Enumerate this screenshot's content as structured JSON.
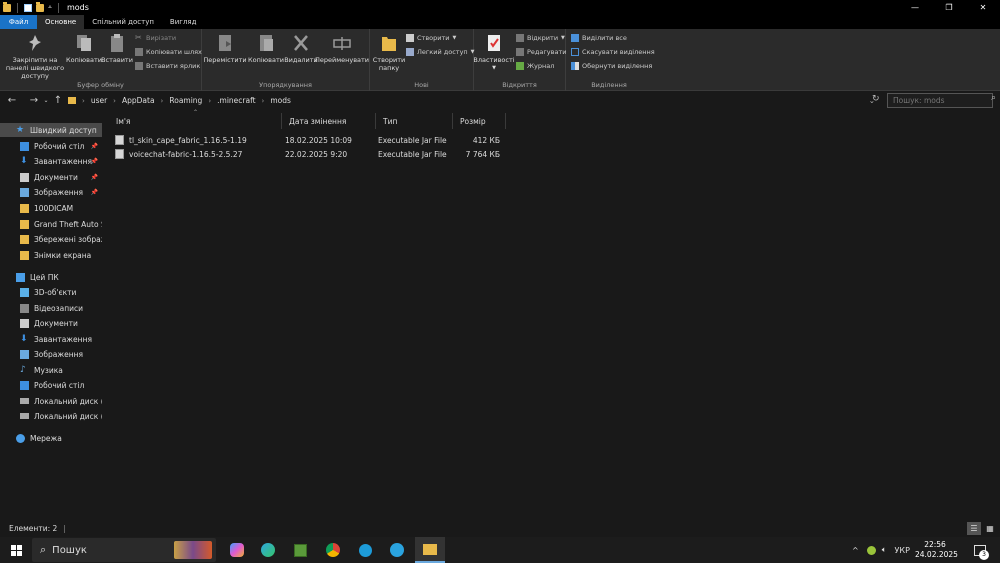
{
  "window": {
    "title": "mods",
    "controls": {
      "minimize": "—",
      "maximize": "❐",
      "close": "✕"
    }
  },
  "tabs": [
    "Файл",
    "Основне",
    "Спільний доступ",
    "Вигляд"
  ],
  "ribbon": {
    "clipboard": {
      "label": "Буфер обміну",
      "pin": "Закріпити на панелі швидкого доступу",
      "copy": "Копіювати",
      "paste": "Вставити",
      "cut": "Вирізати",
      "copy_path": "Копіювати шлях",
      "paste_shortcut": "Вставити ярлик"
    },
    "organize": {
      "label": "Упорядкування",
      "move_to": "Перемістити",
      "copy_to": "Копіювати",
      "delete": "Видалити",
      "rename": "Перейменувати"
    },
    "new": {
      "label": "Нові",
      "new_folder": "Створити папку",
      "new_item": "Створити",
      "easy_access": "Легкий доступ"
    },
    "open": {
      "label": "Відкриття",
      "properties": "Властивості",
      "open": "Відкрити",
      "edit": "Редагувати",
      "history": "Журнал"
    },
    "select": {
      "label": "Виділення",
      "select_all": "Виділити все",
      "select_none": "Скасувати виділення",
      "invert": "Обернути виділення"
    }
  },
  "address": {
    "crumbs": [
      "user",
      "AppData",
      "Roaming",
      ".minecraft",
      "mods"
    ],
    "search_placeholder": "Пошук: mods"
  },
  "navpane": {
    "quick_access": "Швидкий доступ",
    "quick_items": [
      {
        "label": "Робочий стіл",
        "pinned": true
      },
      {
        "label": "Завантаження",
        "pinned": true
      },
      {
        "label": "Документи",
        "pinned": true
      },
      {
        "label": "Зображення",
        "pinned": true
      },
      {
        "label": "100DICAM",
        "pinned": false
      },
      {
        "label": "Grand Theft Auto Sa",
        "pinned": false
      },
      {
        "label": "Збережені зображ",
        "pinned": false
      },
      {
        "label": "Знімки екрана",
        "pinned": false
      }
    ],
    "this_pc": "Цей ПК",
    "pc_items": [
      "3D-об'єкти",
      "Відеозаписи",
      "Документи",
      "Завантаження",
      "Зображення",
      "Музика",
      "Робочий стіл",
      "Локальний диск (C",
      "Локальний диск (D"
    ],
    "network": "Мережа"
  },
  "columns": [
    "Ім'я",
    "Дата змінення",
    "Тип",
    "Розмір"
  ],
  "files": [
    {
      "name": "tl_skin_cape_fabric_1.16.5-1.19",
      "date": "18.02.2025 10:09",
      "type": "Executable Jar File",
      "size": "412 КБ"
    },
    {
      "name": "voicechat-fabric-1.16.5-2.5.27",
      "date": "22.02.2025 9:20",
      "type": "Executable Jar File",
      "size": "7 764 КБ"
    }
  ],
  "status": {
    "items": "Елементи: 2"
  },
  "taskbar": {
    "search": "Пошук",
    "lang": "УКР",
    "time": "22:56",
    "date": "24.02.2025",
    "notifications": "3"
  },
  "colors": {
    "accent": "#1a73c8",
    "folder": "#e8b94a",
    "background": "#191919",
    "ribbon": "#2b2b2b"
  }
}
